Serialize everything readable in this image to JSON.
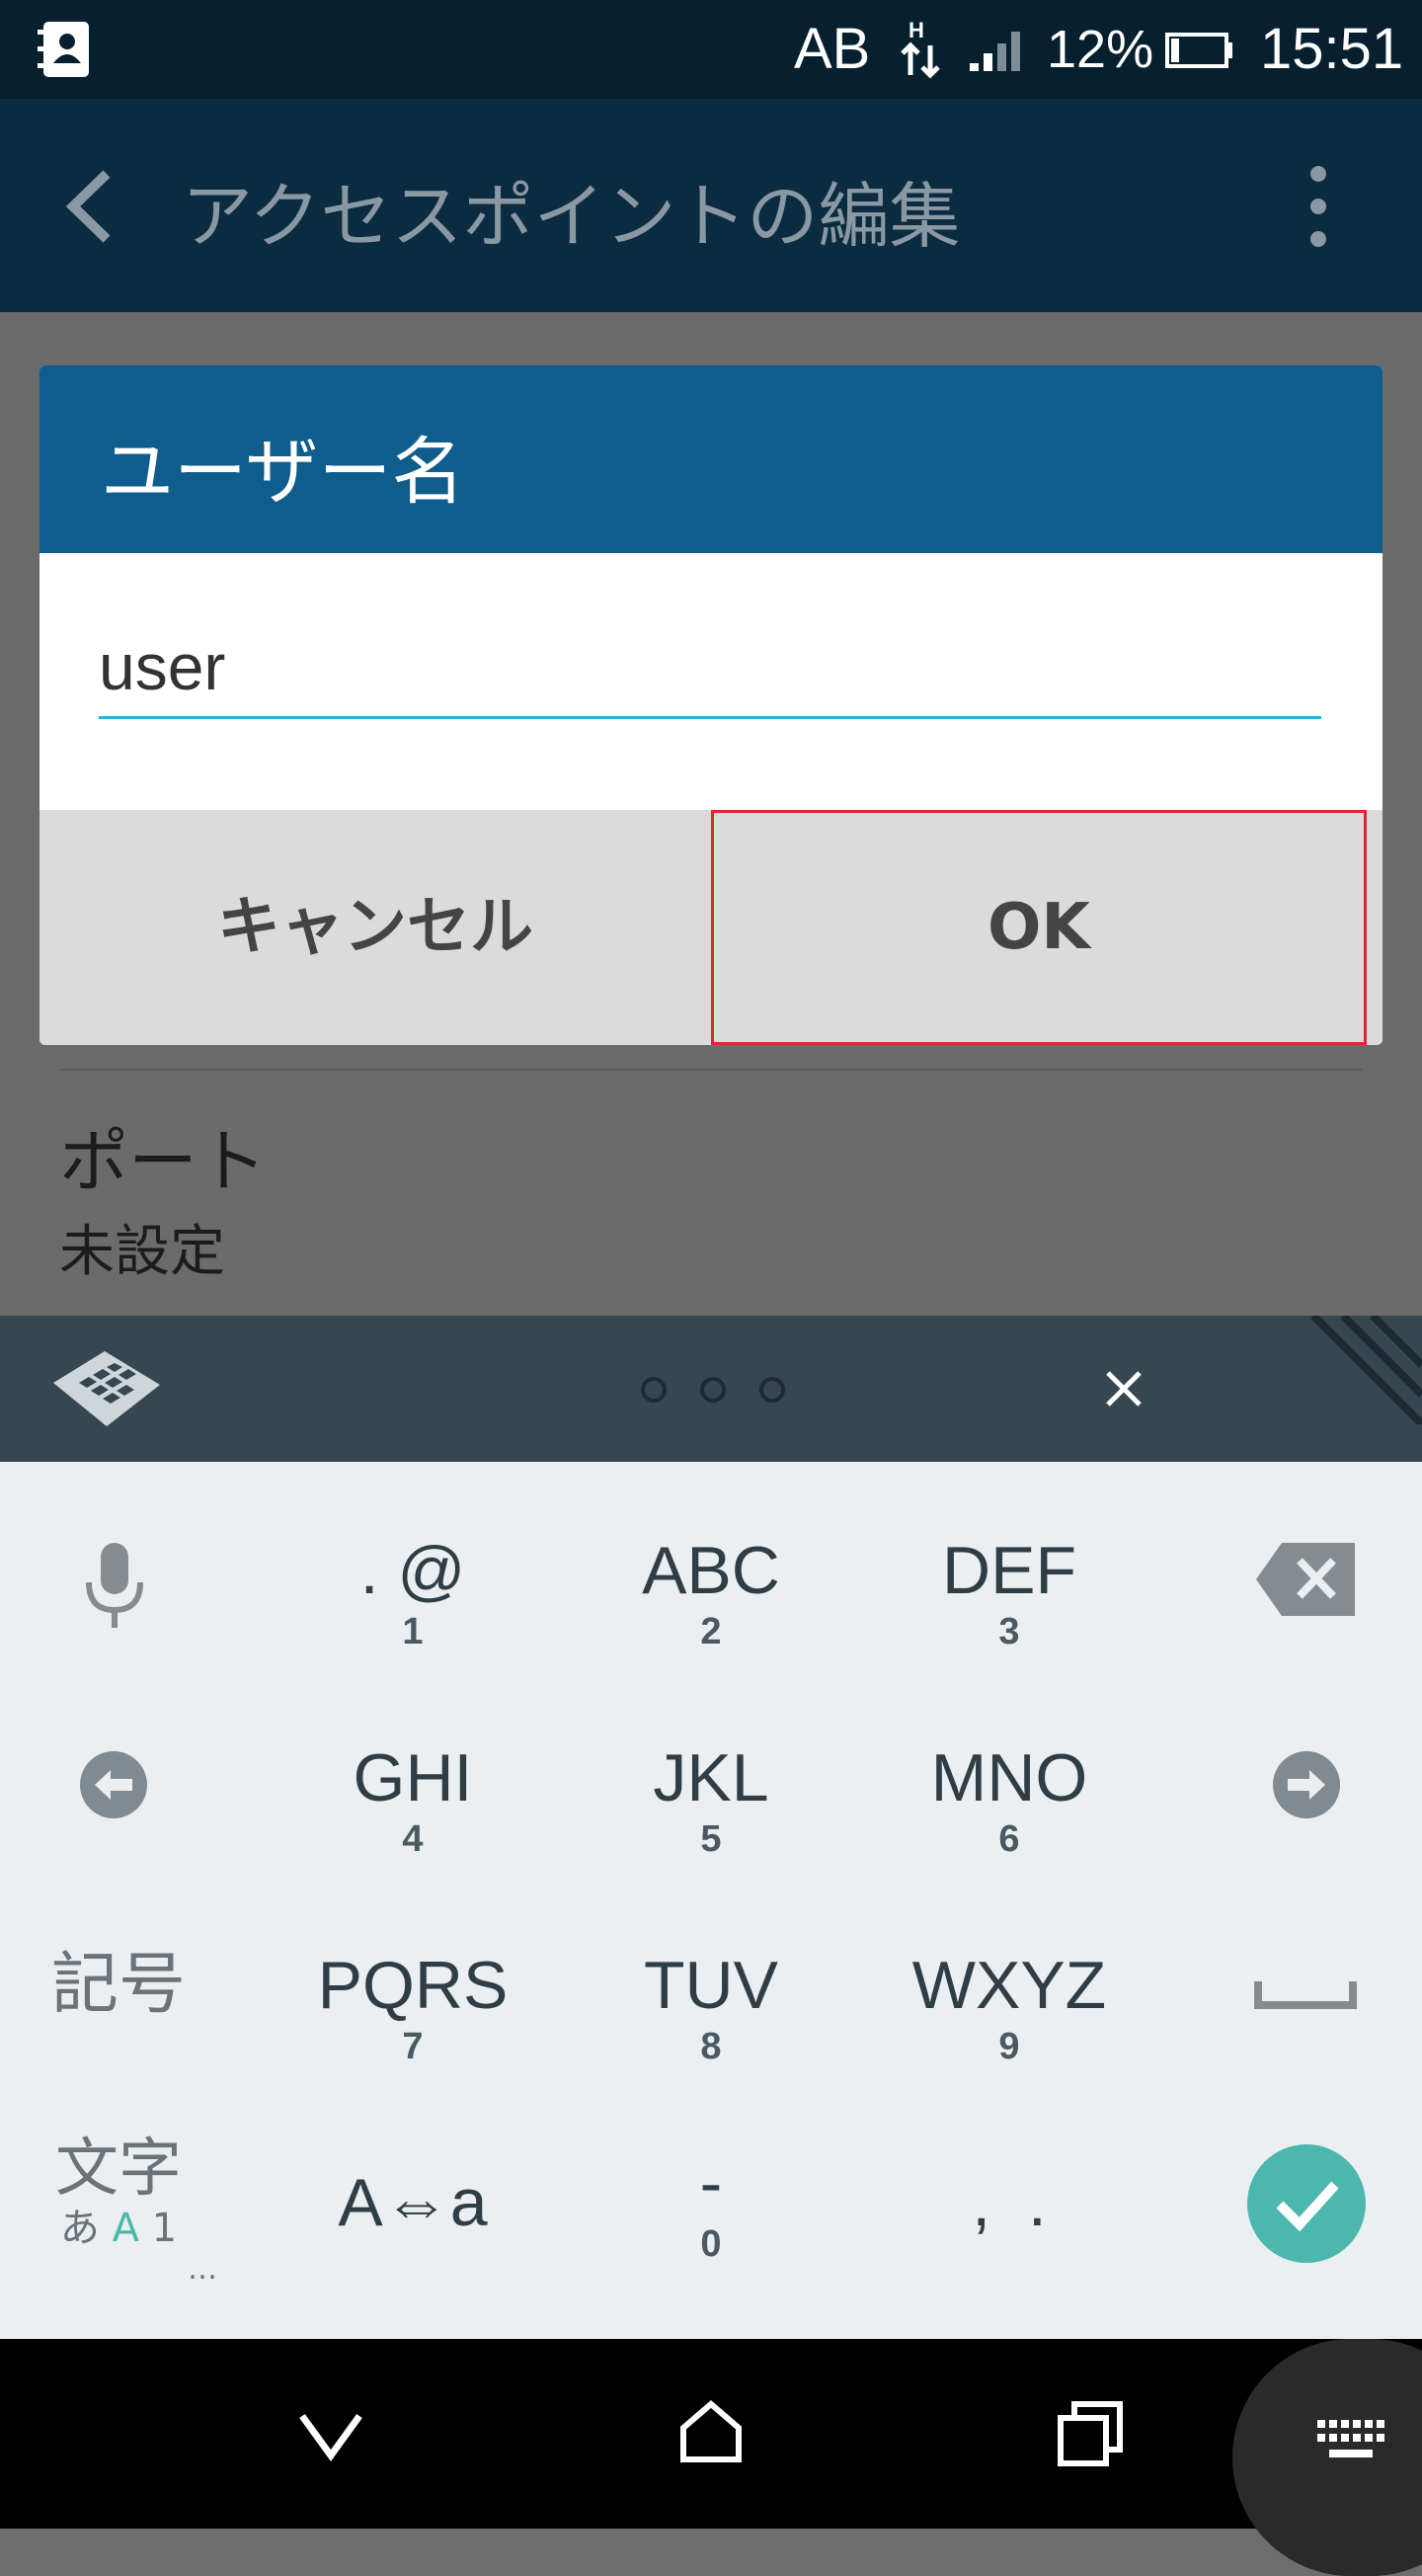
{
  "status_bar": {
    "network_text": "AB",
    "signal_type": "H",
    "battery_percent": "12%",
    "time": "15:51",
    "icons": [
      "contacts-app-icon",
      "data-transfer-icon",
      "signal-icon",
      "battery-icon"
    ]
  },
  "toolbar": {
    "title": "アクセスポイントの編集",
    "icons": [
      "back-icon",
      "overflow-menu-icon"
    ]
  },
  "settings": {
    "items": [
      {
        "title": "ポート",
        "summary": "未設定"
      }
    ]
  },
  "dialog": {
    "title": "ユーザー名",
    "input_value": "user",
    "cancel_label": "キャンセル",
    "ok_label": "OK"
  },
  "keyboard": {
    "header_icons": [
      "keyboard-layout-icon",
      "more-dots-icon",
      "close-icon"
    ],
    "rows": [
      [
        {
          "main": ". @",
          "sub": "1"
        },
        {
          "main": "ABC",
          "sub": "2"
        },
        {
          "main": "DEF",
          "sub": "3"
        }
      ],
      [
        {
          "main": "GHI",
          "sub": "4"
        },
        {
          "main": "JKL",
          "sub": "5"
        },
        {
          "main": "MNO",
          "sub": "6"
        }
      ],
      [
        {
          "main": "PQRS",
          "sub": "7"
        },
        {
          "main": "TUV",
          "sub": "8"
        },
        {
          "main": "WXYZ",
          "sub": "9"
        }
      ],
      [
        {
          "main": "A⇔a",
          "sub": ""
        },
        {
          "main": "-",
          "sub": "0"
        },
        {
          "main": ",  .",
          "sub": ""
        }
      ]
    ],
    "symbol_key": "記号",
    "mode_key": {
      "main": "文字",
      "hira": "あ",
      "alpha": "A",
      "num": "1",
      "more": "…"
    },
    "accent_color": "#4cb8ad"
  },
  "navbar": {
    "icons": [
      "back-chevron-icon",
      "home-icon",
      "recents-icon",
      "keyboard-switch-icon"
    ]
  }
}
